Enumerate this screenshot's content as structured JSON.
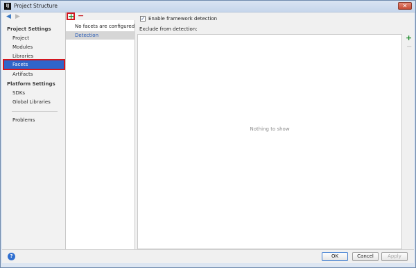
{
  "window": {
    "title": "Project Structure"
  },
  "nav": {
    "project_settings_header": "Project Settings",
    "project_settings_items": [
      "Project",
      "Modules",
      "Libraries",
      "Facets",
      "Artifacts"
    ],
    "platform_settings_header": "Platform Settings",
    "platform_settings_items": [
      "SDKs",
      "Global Libraries"
    ],
    "problems_label": "Problems",
    "selected": "Facets"
  },
  "list": {
    "rows": [
      "No facets are configured",
      "Detection"
    ]
  },
  "detail": {
    "enable_detection_label": "Enable framework detection",
    "enable_detection_checked": true,
    "exclude_label": "Exclude from detection:",
    "empty_text": "Nothing to show"
  },
  "buttons": {
    "ok": "OK",
    "cancel": "Cancel",
    "apply": "Apply"
  },
  "colors": {
    "selection": "#2f65ca",
    "highlight_box": "#d3161f",
    "add_green": "#1f8c2d",
    "remove_red": "#c8242b"
  }
}
